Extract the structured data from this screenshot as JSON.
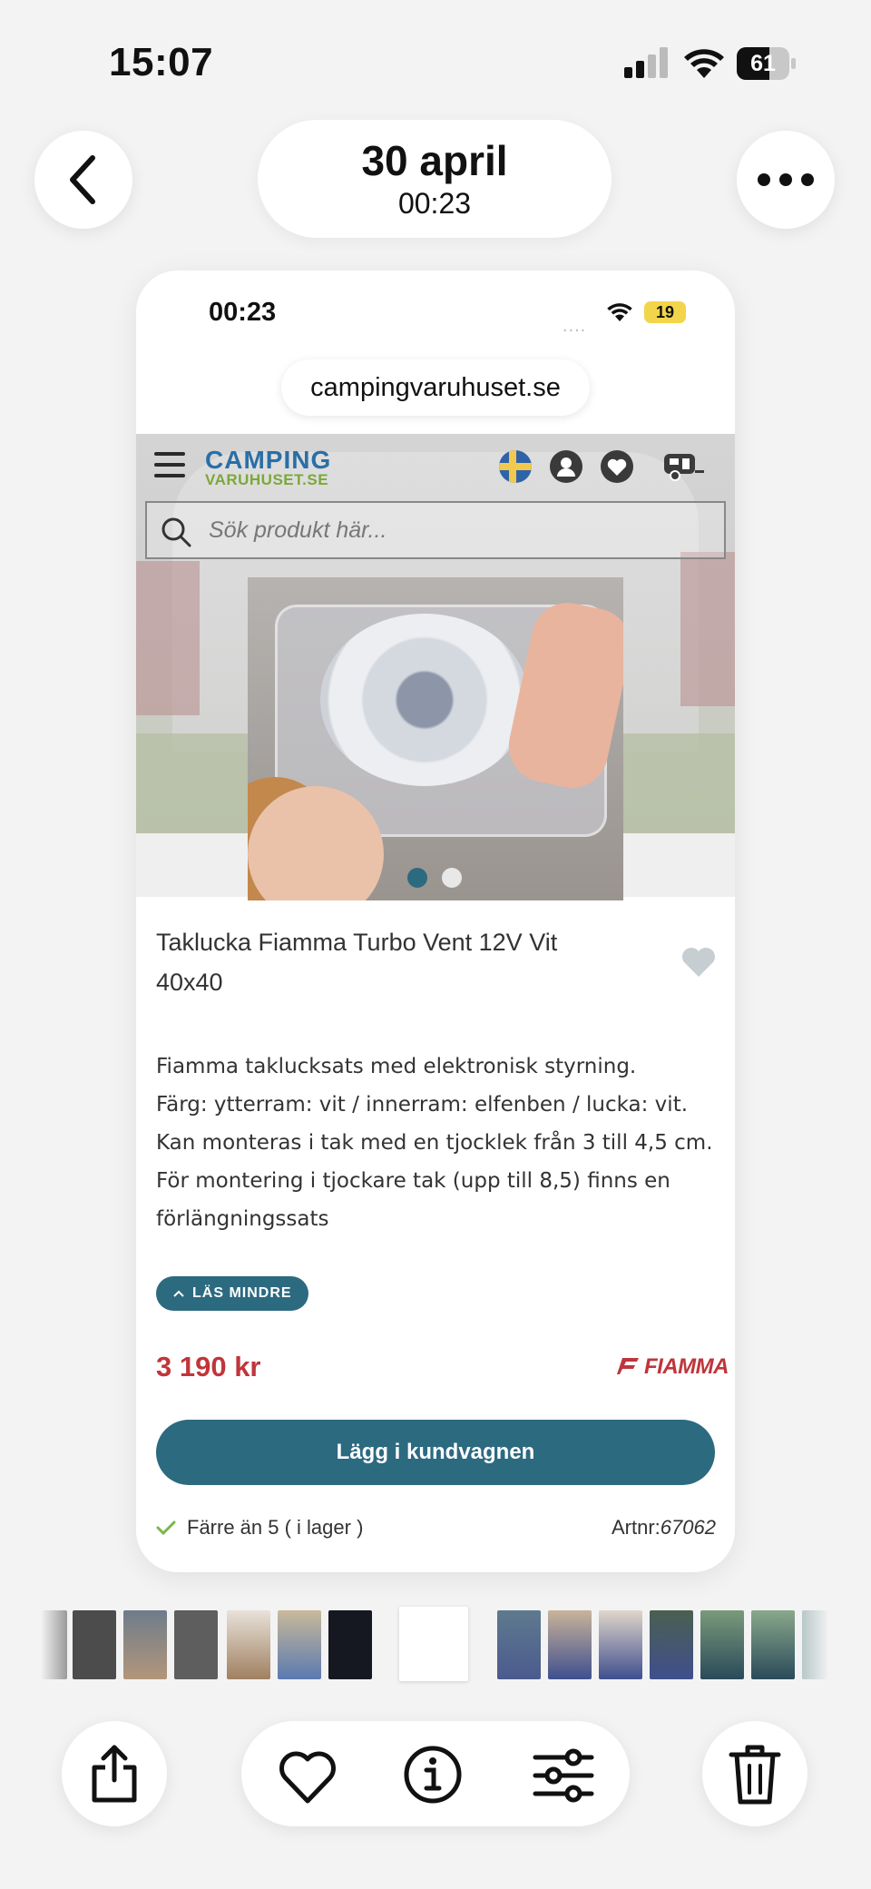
{
  "status_bar": {
    "time": "15:07",
    "battery": "61"
  },
  "photos_header": {
    "date": "30 april",
    "time": "00:23"
  },
  "screenshot": {
    "status_time": "00:23",
    "status_dots": "....",
    "battery": "19",
    "url": "campingvaruhuset.se",
    "site": {
      "logo_line1": "CAMPING",
      "logo_line2": "VARUHUSET.SE",
      "search_placeholder": "Sök produkt här..."
    },
    "product": {
      "title": "Taklucka Fiamma Turbo Vent 12V Vit 40x40",
      "description": [
        "Fiamma taklucksats med elektronisk styrning.",
        "Färg: ytterram: vit / innerram: elfenben / lucka: vit.",
        "Kan monteras i tak med en tjocklek från 3 till 4,5 cm.",
        "För montering i tjockare tak (upp till 8,5) finns en",
        "förlängningssats"
      ],
      "read_less": "LÄS MINDRE",
      "price": "3 190 kr",
      "brand": "FIAMMA",
      "add_to_cart": "Lägg i kundvagnen",
      "stock": "Färre än 5 ( i lager )",
      "artnr_label": "Artnr:",
      "artnr_value": "67062",
      "carousel_active_index": 0,
      "carousel_count": 2
    }
  },
  "colors": {
    "accent": "#2c6a80",
    "price": "#c0353b",
    "logo_blue": "#2a6fa6",
    "logo_green": "#7ba83a",
    "stock_check": "#7ab648"
  },
  "toolbar": {
    "icons": [
      "share-icon",
      "heart-icon",
      "info-icon",
      "adjust-icon",
      "trash-icon"
    ]
  }
}
